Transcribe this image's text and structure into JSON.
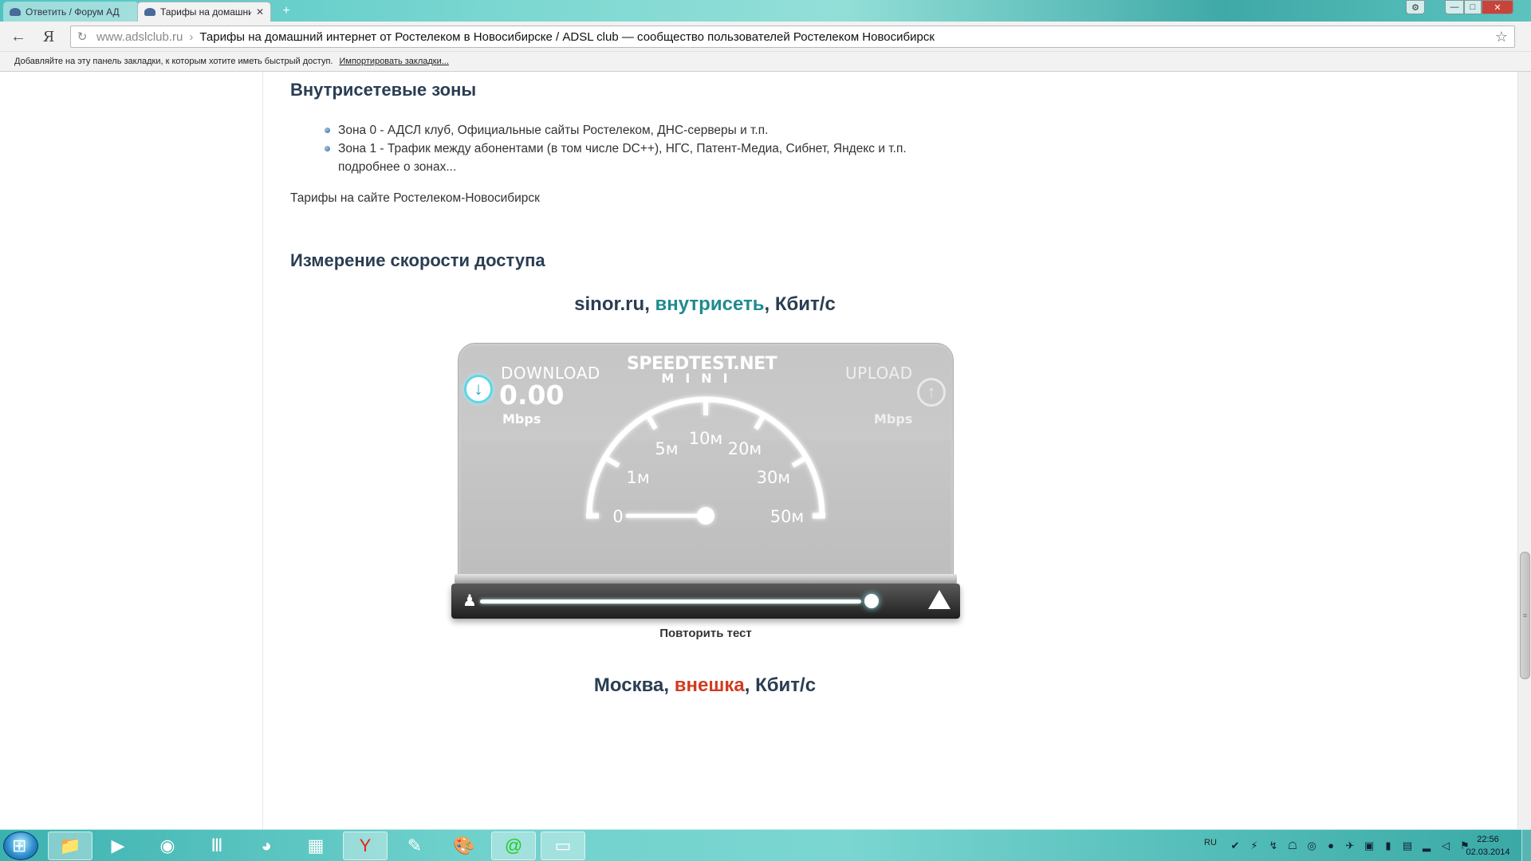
{
  "browser": {
    "tabs": [
      {
        "title": "Ответить / Форум АД",
        "active": false
      },
      {
        "title": "Тарифы на домашни",
        "active": true
      }
    ],
    "new_tab": "+",
    "address": {
      "host": "www.adslclub.ru",
      "separator": "›",
      "page_title": "Тарифы на домашний интернет от Ростелеком в Новосибирске / ADSL club — сообщество пользователей Ростелеком Новосибирск"
    },
    "back_icon": "←",
    "yandex_icon": "Я",
    "reload_icon": "↻",
    "star_icon": "☆",
    "bookmarks_bar": {
      "hint": "Добавляйте на эту панель закладки, к которым хотите иметь быстрый доступ.",
      "import_link": "Импортировать закладки..."
    },
    "window_controls": {
      "settings": "⚙",
      "minimize": "—",
      "maximize": "□",
      "close": "✕"
    }
  },
  "page": {
    "zones_heading": "Внутрисетевые зоны",
    "zones": [
      "Зона 0 - АДСЛ клуб, Официальные сайты Ростелеком, ДНС-серверы и т.п.",
      "Зона 1 - Трафик между абонентами (в том числе DC++), НГС, Патент-Медиа, Сибнет, Яндекс и т.п."
    ],
    "zones_more": "подробнее о зонах...",
    "tariffs_link": "Тарифы на сайте Ростелеком-Новосибирск",
    "speed_heading": "Измерение скорости доступа",
    "test1": {
      "server": "sinor.ru",
      "sep1": ", ",
      "zone": "внутрисеть",
      "sep2": ", ",
      "unit": "Кбит/с"
    },
    "test2": {
      "server": "Москва",
      "sep1": ", ",
      "zone": "внешка",
      "sep2": ", ",
      "unit": "Кбит/с"
    }
  },
  "speedtest": {
    "download_label": "DOWNLOAD",
    "download_value": "0.00",
    "download_unit": "Mbps",
    "upload_label": "UPLOAD",
    "upload_unit": "Mbps",
    "brand_line1": "SPEEDTEST.NET",
    "brand_line2": "MINI",
    "gauge_labels": [
      "0",
      "1м",
      "5м",
      "10м",
      "20м",
      "30м",
      "50м"
    ],
    "needle_value": 0,
    "progress_fraction": 1.0,
    "repeat_button": "Повторить тест"
  },
  "taskbar": {
    "language": "RU",
    "time": "22:56",
    "date": "02.03.2014",
    "apps": [
      "explorer",
      "media-player",
      "chrome",
      "world-of-tanks",
      "firefox",
      "calculator",
      "yandex-browser",
      "notepad",
      "paint",
      "icq",
      "monitor"
    ]
  },
  "colors": {
    "heading": "#2a3d52",
    "internal": "#1f8b8f",
    "external": "#d23b1f"
  }
}
